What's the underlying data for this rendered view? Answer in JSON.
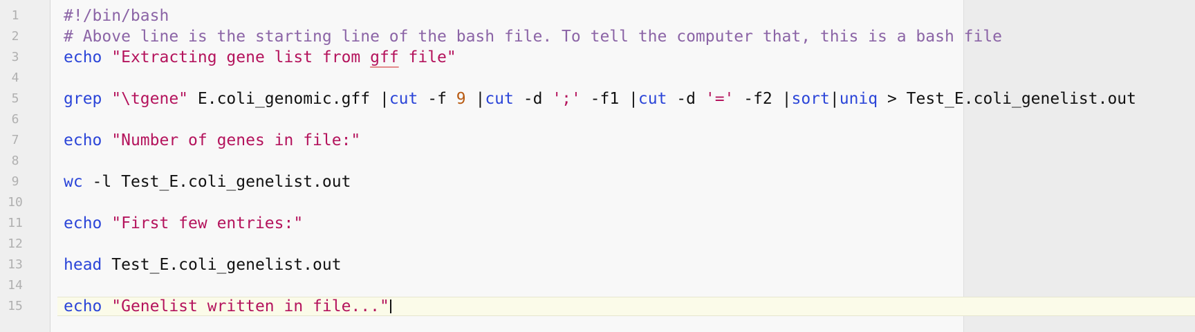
{
  "editor": {
    "lines": [
      {
        "number": "1",
        "tokens": [
          {
            "type": "comment",
            "text": "#!/bin/bash"
          }
        ]
      },
      {
        "number": "2",
        "tokens": [
          {
            "type": "comment",
            "text": "# Above line is the starting line of the bash file. To tell the computer that, this is a bash file"
          }
        ]
      },
      {
        "number": "3",
        "tokens": [
          {
            "type": "kw",
            "text": "echo"
          },
          {
            "type": "plain",
            "text": " "
          },
          {
            "type": "str",
            "text": "\"Extracting gene list from "
          },
          {
            "type": "spell",
            "text": "gff"
          },
          {
            "type": "str",
            "text": " file\""
          }
        ]
      },
      {
        "number": "4",
        "tokens": []
      },
      {
        "number": "5",
        "tokens": [
          {
            "type": "kw",
            "text": "grep"
          },
          {
            "type": "plain",
            "text": " "
          },
          {
            "type": "str",
            "text": "\"\\tgene\""
          },
          {
            "type": "plain",
            "text": " E.coli_genomic.gff |"
          },
          {
            "type": "kw",
            "text": "cut"
          },
          {
            "type": "plain",
            "text": " -f "
          },
          {
            "type": "num",
            "text": "9"
          },
          {
            "type": "plain",
            "text": " |"
          },
          {
            "type": "kw",
            "text": "cut"
          },
          {
            "type": "plain",
            "text": " -d "
          },
          {
            "type": "str",
            "text": "';'"
          },
          {
            "type": "plain",
            "text": " -f1 |"
          },
          {
            "type": "kw",
            "text": "cut"
          },
          {
            "type": "plain",
            "text": " -d "
          },
          {
            "type": "str",
            "text": "'='"
          },
          {
            "type": "plain",
            "text": " -f2 |"
          },
          {
            "type": "kw",
            "text": "sort"
          },
          {
            "type": "plain",
            "text": "|"
          },
          {
            "type": "kw",
            "text": "uniq"
          },
          {
            "type": "plain",
            "text": " > Test_E.coli_genelist.out"
          }
        ]
      },
      {
        "number": "6",
        "tokens": []
      },
      {
        "number": "7",
        "tokens": [
          {
            "type": "kw",
            "text": "echo"
          },
          {
            "type": "plain",
            "text": " "
          },
          {
            "type": "str",
            "text": "\"Number of genes in file:\""
          }
        ]
      },
      {
        "number": "8",
        "tokens": []
      },
      {
        "number": "9",
        "tokens": [
          {
            "type": "kw",
            "text": "wc"
          },
          {
            "type": "plain",
            "text": " -l Test_E.coli_genelist.out"
          }
        ]
      },
      {
        "number": "10",
        "tokens": []
      },
      {
        "number": "11",
        "tokens": [
          {
            "type": "kw",
            "text": "echo"
          },
          {
            "type": "plain",
            "text": " "
          },
          {
            "type": "str",
            "text": "\"First few entries:\""
          }
        ]
      },
      {
        "number": "12",
        "tokens": []
      },
      {
        "number": "13",
        "tokens": [
          {
            "type": "kw",
            "text": "head"
          },
          {
            "type": "plain",
            "text": " Test_E.coli_genelist.out"
          }
        ]
      },
      {
        "number": "14",
        "tokens": []
      },
      {
        "number": "15",
        "tokens": [
          {
            "type": "kw",
            "text": "echo"
          },
          {
            "type": "plain",
            "text": " "
          },
          {
            "type": "str",
            "text": "\"Genelist written in file...\""
          }
        ],
        "current": true
      }
    ]
  },
  "colors": {
    "comment": "#8b64a6",
    "keyword": "#2b45d8",
    "string": "#b4135c",
    "number": "#b85a12",
    "plain": "#111111",
    "line_number": "#b0b0b0",
    "spellcheck_underline": "#e38a8a"
  }
}
